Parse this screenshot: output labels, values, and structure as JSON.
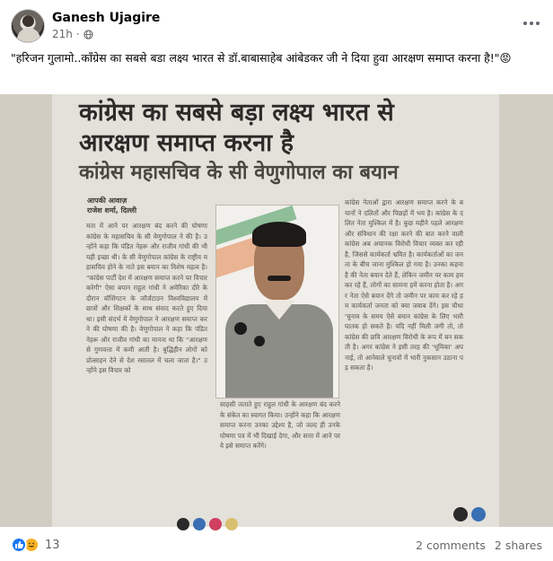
{
  "post": {
    "author": "Ganesh Ujagire",
    "time": "21h",
    "meta_sep": "·",
    "caption": "\"हरिजन गुलामो..कॉंग्रेस का सबसे बडा लक्ष्य भारत से डॉ.बाबासाहेब आंबेडकर जी ने दिया हुवा आरक्षण समाप्त करना है!\"😡"
  },
  "newspaper": {
    "headline_line1": "कांग्रेस का सबसे बड़ा लक्ष्य भारत से",
    "headline_line2": "आरक्षण समाप्त करना है",
    "subheadline": "कांग्रेस महासचिव के सी वेणुगोपाल का बयान",
    "byline_1": "आपकी आवाज़",
    "byline_2": "राजेश शर्मा, दिल्ली",
    "col1_text": "मता में आने पर आरक्षण बंद करने की घोषणा कांग्रेस के महासचिव के सी वेणुगोपाल ने की है। उन्होंने कहा कि पंडित नेहरू और राजीव गांधी की भी यही इच्छा थी। के सी वेणुगोपाल कांग्रेस के राष्ट्रीय महासचिव होने के नाते इस बयान का विशेष महत्व है। \"कांग्रेस पार्टी देश में आरक्षण समाप्त करने पर विचार करेगी\" ऐसा बयान राहुल गांधी ने अमेरिका दौरे के दौरान वॉशिंगटन के जॉर्जटाउन विश्वविद्यालय में छात्रों और शिक्षकों के साथ संवाद करते हुए दिया था। इसी संदर्भ में वेणुगोपाल ने आरक्षण समाप्त करने की घोषणा की है। वेणुगोपाल ने कहा कि पंडित नेहरू और राजीव गांधी का मानना था कि \"आरक्षण से गुणवत्ता में कमी आती है। बुद्धिहीन लोगों को प्रोत्साहन देने से देश रसातल में चला जाता है।\" उन्होंने इस विचार को",
    "col2_text": "साहसी जताते हुए राहुल गांधी के आरक्षण बंद करने के संकेत का स्वागत किया। उन्होंने कहा कि आरक्षण समाप्त करना उनका उद्देश्य है, जो जल्द ही उनके घोषणा पत्र में भी दिखाई देगा, और सत्ता में आने पर वे इसे समाप्त करेंगे।",
    "col3_text": "कांग्रेस नेताओं द्वारा आरक्षण समाप्त करने के बयानों ने दलितों और पिछड़ों में भय है। कांग्रेस के दलित नेता मुश्किल में है। कुछ महीने पहले आरक्षण और संविधान की रक्षा करने की बात करने वाली कांग्रेस अब अचानक विरोधी विचार व्यक्त कर रही है, जिससे कार्यकर्ता भ्रमित है। कार्यकर्ताओं का जनता के बीच जाना मुश्किल हो गया है। उनका कहना है की नेता बयान देते हैं, लेकिन जमीन पर काम हम कर रहे हैं, लोगों का सामना हमें करना होता है। अगर नेता ऐसे बयान देंगे तो जमीन पर काम कर रहे हम कार्यकर्ता जनता को क्या जवाब देंगे। इस चौथा 'चुनाव के समय ऐसे बयान कांग्रेस के लिए भारी घातक हो सकते है। यदि नहीं मिली जगी तो, तो कांग्रेस की छवि आरक्षण विरोधी के रूप में बन सकती है। अगर कांग्रेस ने इसी तरह की 'भूमिका' अपनाई, तो आनेवाले चुनावों में भारी नुकसान उठाना पड़ सकता है।"
  },
  "footer": {
    "reaction_count": "13",
    "comments": "2 comments",
    "shares": "2 shares"
  },
  "icons": {
    "like": "like-icon",
    "haha": "haha-icon",
    "globe": "globe-icon",
    "more": "more-options-icon"
  },
  "colors": {
    "accent": "#1877f2",
    "secondary_text": "#65676b"
  }
}
